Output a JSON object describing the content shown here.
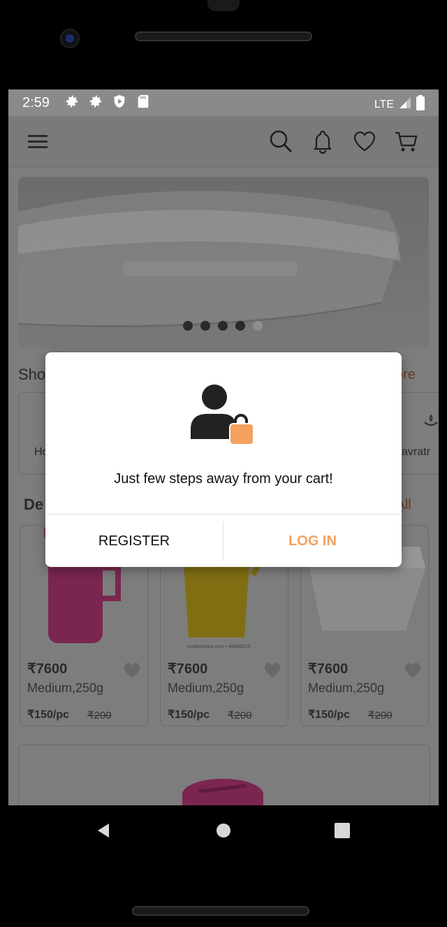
{
  "status_bar": {
    "time": "2:59",
    "network": "LTE",
    "icons": [
      "settings-icon",
      "settings-icon",
      "shield-play-icon",
      "sd-card-icon"
    ]
  },
  "app_bar": {
    "icons": [
      "menu-icon",
      "search-icon",
      "bell-icon",
      "heart-icon",
      "cart-icon"
    ]
  },
  "banner": {
    "dots_total": 5,
    "active_dot": 5
  },
  "categories_section": {
    "title_partial": "Sho",
    "more_partial": "ore",
    "items": [
      {
        "label": "Ho"
      },
      {
        "label": "avratr"
      }
    ]
  },
  "deals_section": {
    "title_partial": "De",
    "view_all_partial": "v All"
  },
  "products": [
    {
      "price": "₹7600",
      "size": "Medium,250g",
      "unit_price": "₹150/pc",
      "mrp": "₹200"
    },
    {
      "price": "₹7600",
      "size": "Medium,250g",
      "unit_price": "₹150/pc",
      "mrp": "₹200",
      "watermark": "shutterstock.com • 46686525"
    },
    {
      "price": "₹7600",
      "size": "Medium,250g",
      "unit_price": "₹150/pc",
      "mrp": "₹200"
    }
  ],
  "modal": {
    "message": "Just few steps away from your cart!",
    "register_label": "REGISTER",
    "login_label": "LOG IN",
    "accent_color": "#f5a05c"
  },
  "nav_bar": {
    "icons": [
      "back-icon",
      "home-icon",
      "recents-icon"
    ]
  }
}
